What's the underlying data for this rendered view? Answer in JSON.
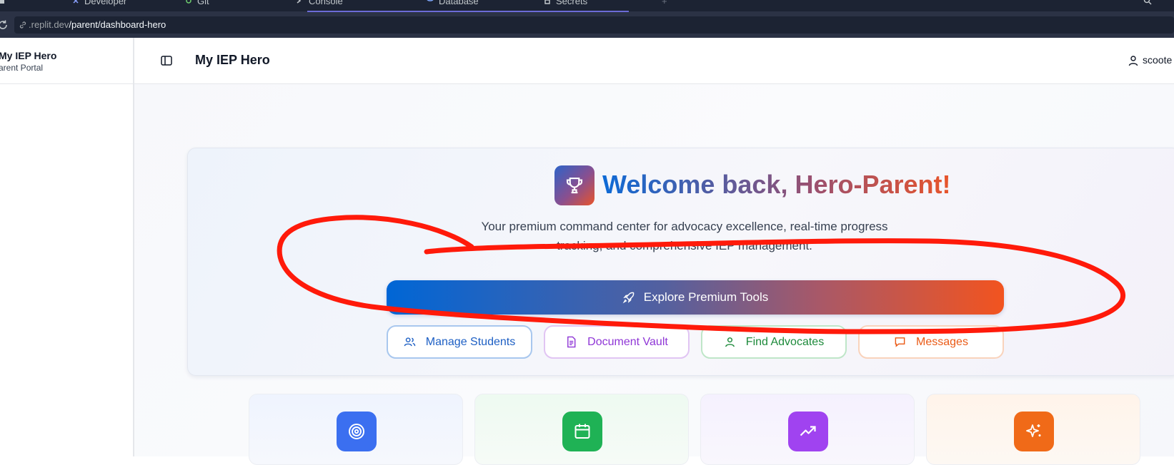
{
  "browser": {
    "tabs": [
      {
        "label": "Developer"
      },
      {
        "label": "Git"
      },
      {
        "label": "Console"
      },
      {
        "label": "Database"
      },
      {
        "label": "Secrets"
      }
    ],
    "url_host": ".replit.dev",
    "url_path": "/parent/dashboard-hero"
  },
  "sidebar": {
    "brand": "My IEP Hero",
    "subtitle": "arent Portal"
  },
  "header": {
    "title": "My IEP Hero",
    "user": "scoote"
  },
  "hero": {
    "welcome_prefix": "Welcome back, ",
    "welcome_name": "Hero-Parent!",
    "description": "Your premium command center for advocacy excellence, real-time progress tracking, and comprehensive IEP management.",
    "cta_label": "Explore Premium Tools",
    "quick_actions": [
      {
        "label": "Manage Students",
        "icon": "users-icon"
      },
      {
        "label": "Document Vault",
        "icon": "file-text-icon"
      },
      {
        "label": "Find Advocates",
        "icon": "user-icon"
      },
      {
        "label": "Messages",
        "icon": "message-square-icon"
      }
    ]
  },
  "cards": [
    {
      "icon": "target-icon",
      "color": "#3b6ff0"
    },
    {
      "icon": "calendar-icon",
      "color": "#1fb255"
    },
    {
      "icon": "trending-up-icon",
      "color": "#a043f0"
    },
    {
      "icon": "sparkles-icon",
      "color": "#f06a18"
    }
  ],
  "colors": {
    "annotation_red": "#ff1a0a",
    "gradient_start": "#0066d6",
    "gradient_end": "#f2541f"
  }
}
